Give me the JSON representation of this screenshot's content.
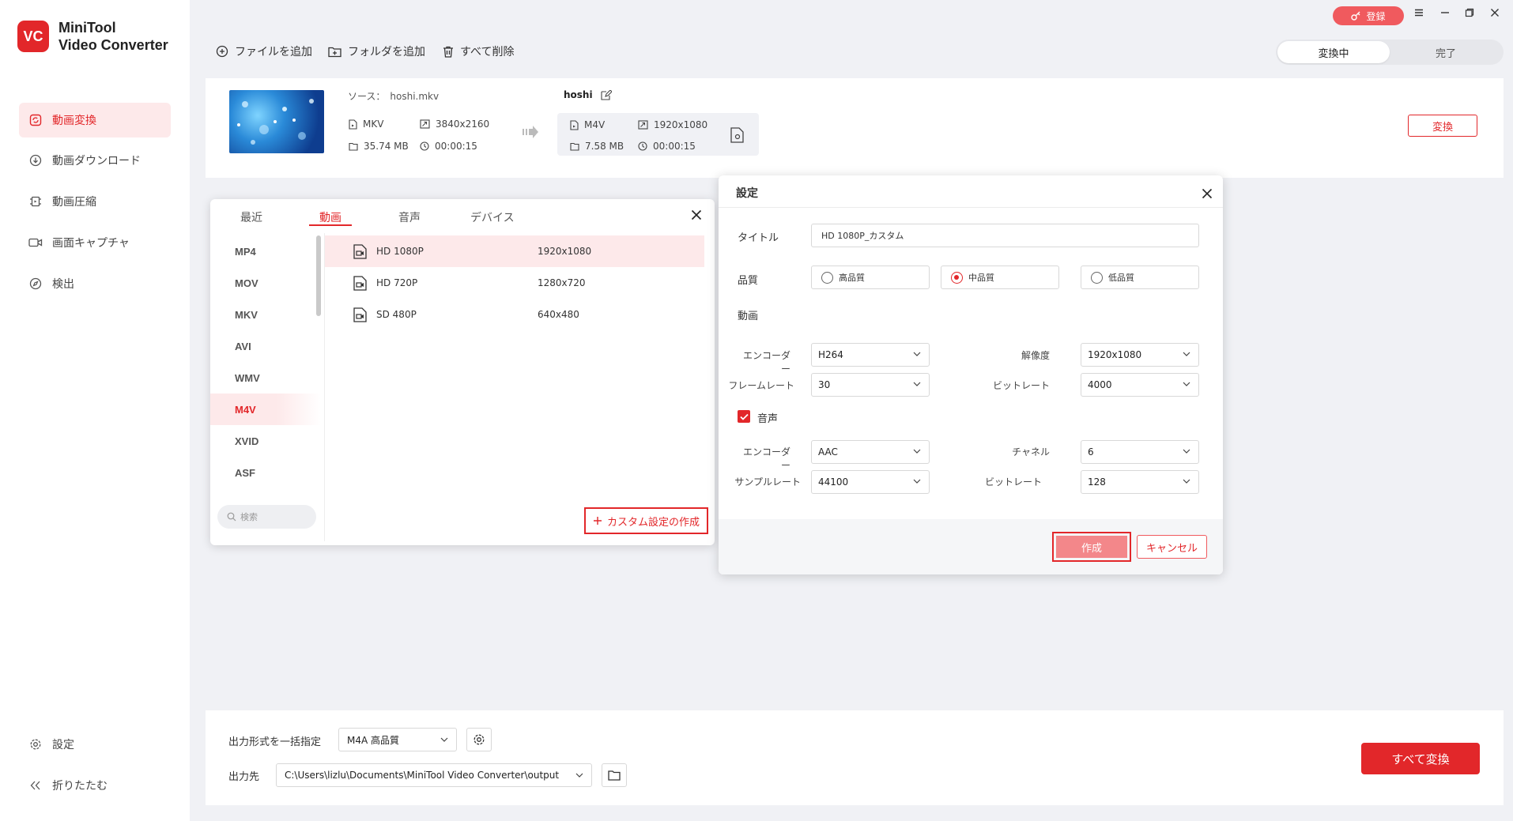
{
  "app": {
    "logo_mark": "VC",
    "name_line1": "MiniTool",
    "name_line2": "Video Converter"
  },
  "sidebar": {
    "items": [
      {
        "label": "動画変換",
        "icon": "convert-icon",
        "active": true
      },
      {
        "label": "動画ダウンロード",
        "icon": "download-icon"
      },
      {
        "label": "動画圧縮",
        "icon": "compress-icon"
      },
      {
        "label": "画面キャプチャ",
        "icon": "camera-icon"
      },
      {
        "label": "検出",
        "icon": "compass-icon"
      }
    ],
    "settings_label": "設定",
    "collapse_label": "折りたたむ"
  },
  "toolbar": {
    "add_file": "ファイルを追加",
    "add_folder": "フォルダを追加",
    "delete_all": "すべて削除"
  },
  "titlebar": {
    "register": "登録"
  },
  "segment": {
    "converting": "変換中",
    "done": "完了"
  },
  "file": {
    "source_label": "ソース：",
    "source_name": "hoshi.mkv",
    "src_format": "MKV",
    "src_resolution": "3840x2160",
    "src_size": "35.74 MB",
    "src_duration": "00:00:15",
    "target_name": "hoshi",
    "dst_format": "M4V",
    "dst_resolution": "1920x1080",
    "dst_size": "7.58 MB",
    "dst_duration": "00:00:15",
    "convert_label": "変換"
  },
  "format_panel": {
    "tabs": [
      "最近",
      "動画",
      "音声",
      "デバイス"
    ],
    "active_tab": "動画",
    "formats": [
      "MP4",
      "MOV",
      "MKV",
      "AVI",
      "WMV",
      "M4V",
      "XVID",
      "ASF"
    ],
    "active_format": "M4V",
    "presets": [
      {
        "name": "HD 1080P",
        "resolution": "1920x1080"
      },
      {
        "name": "HD 720P",
        "resolution": "1280x720"
      },
      {
        "name": "SD 480P",
        "resolution": "640x480"
      }
    ],
    "search_placeholder": "検索",
    "custom_button": "カスタム設定の作成"
  },
  "settings_dialog": {
    "title": "設定",
    "title_label": "タイトル",
    "title_value": "HD 1080P_カスタム",
    "quality_label": "品質",
    "quality_options": [
      "高品質",
      "中品質",
      "低品質"
    ],
    "quality_selected": "中品質",
    "video_label": "動画",
    "video": {
      "encoder_label": "エンコーダー",
      "encoder": "H264",
      "resolution_label": "解像度",
      "resolution": "1920x1080",
      "framerate_label": "フレームレート",
      "framerate": "30",
      "bitrate_label": "ビットレート",
      "bitrate": "4000"
    },
    "audio_label": "音声",
    "audio_checked": true,
    "audio": {
      "encoder_label": "エンコーダー",
      "encoder": "AAC",
      "channel_label": "チャネル",
      "channel": "6",
      "samplerate_label": "サンプルレート",
      "samplerate": "44100",
      "bitrate_label": "ビットレート",
      "bitrate": "128"
    },
    "create_button": "作成",
    "cancel_button": "キャンセル"
  },
  "bottom": {
    "output_format_label": "出力形式を一括指定",
    "output_format_value": "M4A 高品質",
    "output_dir_label": "出力先",
    "output_dir_value": "C:\\Users\\lizlu\\Documents\\MiniTool Video Converter\\output",
    "convert_all": "すべて変換"
  },
  "colors": {
    "accent": "#e2272a",
    "accent_light": "#fde9ea",
    "background": "#f0f1f5"
  }
}
